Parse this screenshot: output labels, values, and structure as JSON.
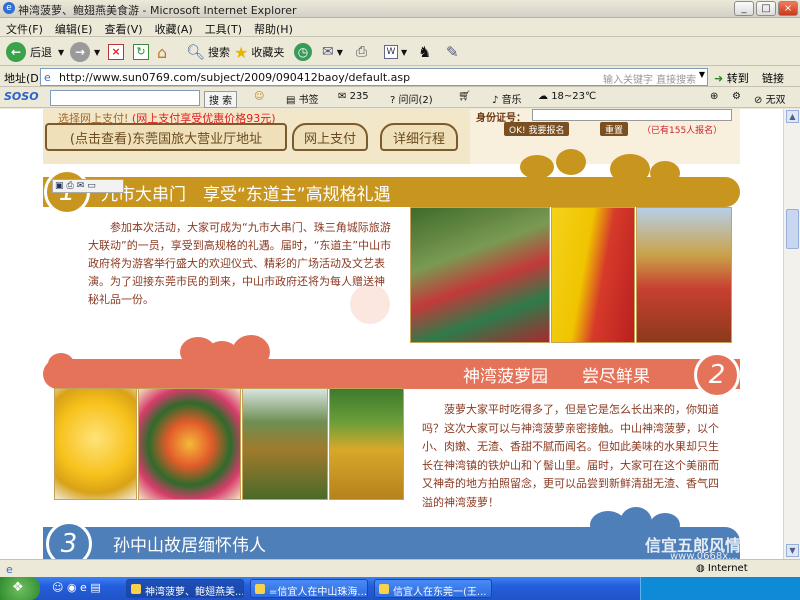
{
  "window": {
    "title": "神湾菠萝、鲍翅燕美食游 - Microsoft Internet Explorer"
  },
  "menu": [
    "文件(F)",
    "编辑(E)",
    "查看(V)",
    "收藏(A)",
    "工具(T)",
    "帮助(H)"
  ],
  "toolbar": {
    "back": "后退",
    "search": "搜索",
    "favorites": "收藏夹"
  },
  "address": {
    "label": "地址(D)",
    "url": "http://www.sun0769.com/subject/2009/090412baoy/default.asp",
    "search_hint": "输入关键字 直接搜索",
    "go": "转到",
    "links": "链接"
  },
  "soso": {
    "logo": "SOSO",
    "search_btn": "搜 索",
    "bookmarks": "书签",
    "mail_count": "235",
    "ask": "问问(2)",
    "music": "音乐",
    "weather": "18~23℃",
    "no_ads": "无双"
  },
  "page": {
    "pay_line": "选择网上支付!",
    "pay_discount": "(网上支付享受优惠价格93元)",
    "office_link": "(点击查看)东莞国旅大营业厅地址",
    "online_pay": "网上支付",
    "itinerary": "详细行程",
    "id_label": "身份证号：",
    "signup_btn": "OK! 我要报名",
    "reset_btn": "重置",
    "signup_count": "（已有155人报名）",
    "section1": {
      "title": "九市大串门　享受“东道主”高规格礼遇",
      "number": "1",
      "text": "参加本次活动，大家可成为“九市大串门、珠三角城际旅游大联动”的一员，享受到高规格的礼遇。届时，“东道主”中山市政府将为游客举行盛大的欢迎仪式、精彩的广场活动及文艺表演。为了迎接东莞市民的到来，中山市政府还将为每人赠送神秘礼品一份。"
    },
    "section2": {
      "title": "神湾菠萝园　　尝尽鲜果",
      "number": "2",
      "text": "菠萝大家平时吃得多了，但是它是怎么长出来的，你知道吗？这次大家可以与神湾菠萝亲密接触。中山神湾菠萝，以个小、肉嫩、无渣、香甜不腻而闻名。但如此美味的水果却只生长在神湾镇的铁炉山和丫髻山里。届时，大家可在这个美丽而又神奇的地方拍照留念，更可以品尝到新鲜清甜无渣、香气四溢的神湾菠萝！"
    },
    "section3": {
      "title": "孙中山故居缅怀伟人",
      "number": "3"
    }
  },
  "statusbar": {
    "zone": "Internet"
  },
  "taskbar": {
    "tasks": [
      "神湾菠萝、鲍翅燕美...",
      "=信宜人在中山珠海...",
      "信宜人在东莞一(王..."
    ],
    "watermark": "信宜五郎风情",
    "watermark_url": "www.0668x..."
  },
  "colors": {
    "gold_band": "#c8951e",
    "orange_band": "#e5735a",
    "blue_band": "#4f7fb8",
    "brown_text": "#8a3a22"
  }
}
